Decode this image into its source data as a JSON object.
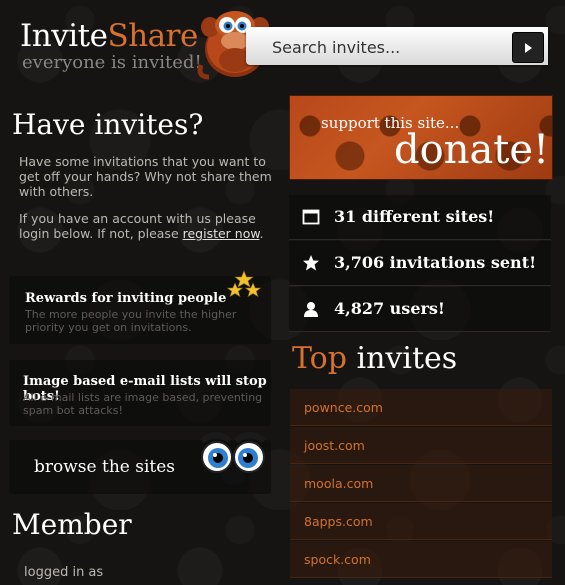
{
  "header": {
    "logo_part1": "Invite",
    "logo_part2": "Share",
    "tagline": "everyone is invited!",
    "search_placeholder": "Search invites...",
    "search_button_icon": "play-arrow-icon"
  },
  "left": {
    "have_title": "Have invites?",
    "intro": "Have some invitations that you want to get off your hands? Why not share them with others.",
    "account_prefix": "If you have an account with us please login below. If not, please ",
    "register_link": "register now",
    "account_suffix": ".",
    "features": [
      {
        "title": "Rewards for inviting people",
        "desc": "The more people you invite the higher priority you get on invitations."
      },
      {
        "title": "Image based e-mail lists will stop bots!",
        "desc": "All e-mail lists are image based, preventing spam bot attacks!"
      }
    ],
    "browse_label": "browse the sites",
    "member_title": "Member",
    "logged_in": "logged in as"
  },
  "right": {
    "donate_small": "support this site...",
    "donate_big": "donate!",
    "stats": [
      {
        "icon": "window-icon",
        "text": "31 different sites!"
      },
      {
        "icon": "star-icon",
        "text": "3,706 invitations sent!"
      },
      {
        "icon": "user-icon",
        "text": "4,827 users!"
      }
    ],
    "top_title_accent": "Top",
    "top_title_rest": " invites",
    "invites": [
      "pownce.com",
      "joost.com",
      "moola.com",
      "8apps.com",
      "spock.com"
    ]
  },
  "colors": {
    "accent": "#d8702e",
    "background": "#161412",
    "donate": "#c6561f"
  }
}
